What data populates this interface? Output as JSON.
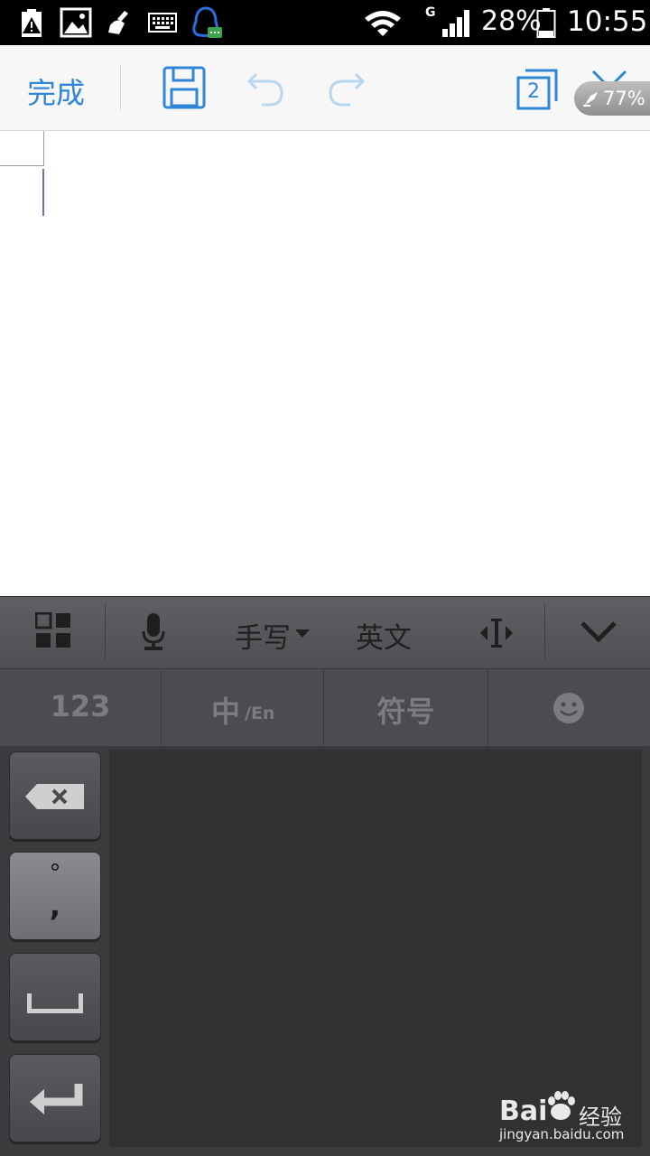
{
  "status_bar": {
    "network_type": "G",
    "battery_percent": "28%",
    "time": "10:55"
  },
  "toolbar": {
    "done_label": "完成",
    "page_count": "2"
  },
  "floating_badge": {
    "label": "77%"
  },
  "keyboard": {
    "handwriting_label": "手写",
    "english_label": "英文",
    "tabs": {
      "numbers": "123",
      "chinese": "中",
      "english_sub": "/En",
      "symbols": "符号"
    },
    "punct_top": "°",
    "punct_bottom": ","
  },
  "watermark": {
    "brand": "Bai",
    "brand_cn": "经验",
    "url": "jingyan.baidu.com"
  }
}
